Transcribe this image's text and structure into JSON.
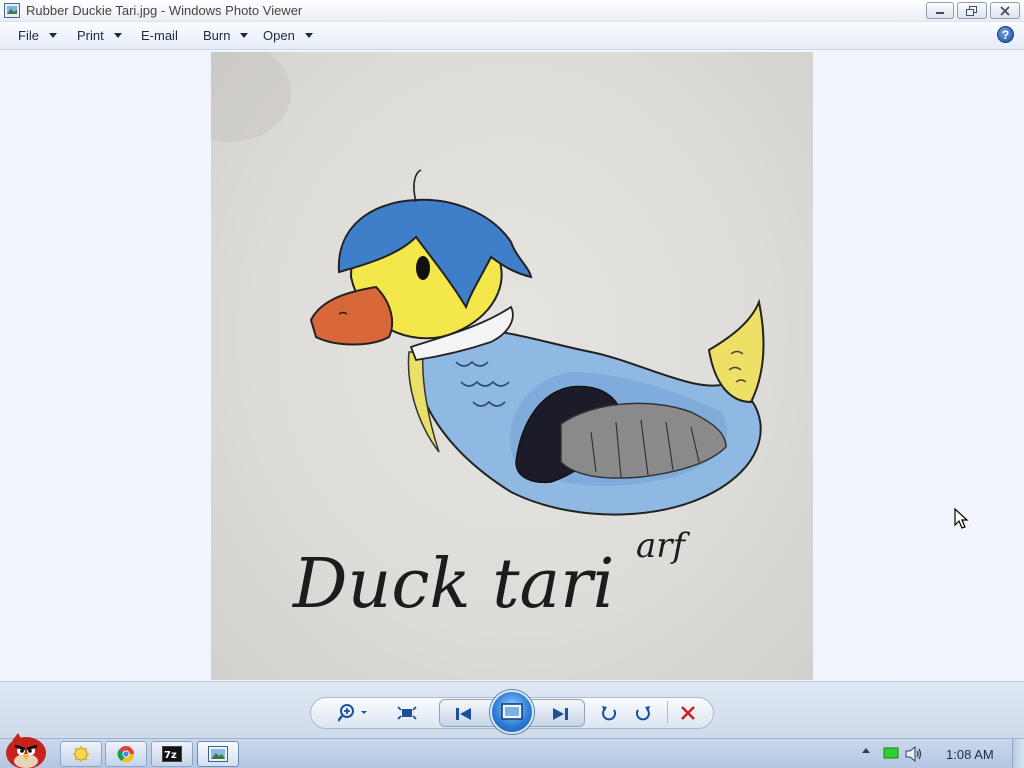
{
  "window": {
    "title": "Rubber Duckie Tari.jpg - Windows Photo Viewer"
  },
  "menu": {
    "items": [
      {
        "label": "File",
        "has_caret": true
      },
      {
        "label": "Print",
        "has_caret": true
      },
      {
        "label": "E-mail",
        "has_caret": false
      },
      {
        "label": "Burn",
        "has_caret": true
      },
      {
        "label": "Open",
        "has_caret": true
      }
    ],
    "help_label": "?"
  },
  "photo": {
    "caption_text": "Duck tari",
    "signature_text": "arf"
  },
  "controls": {
    "icons": [
      "zoom-icon",
      "fit-to-window-icon",
      "previous-icon",
      "slideshow-icon",
      "next-icon",
      "rotate-counterclockwise-icon",
      "rotate-clockwise-icon",
      "delete-icon"
    ]
  },
  "taskbar": {
    "start_icon": "angry-bird-orb-icon",
    "buttons": [
      "explorer-icon",
      "chrome-icon",
      "7zip-icon",
      "photo-viewer-icon"
    ],
    "tray_icons": [
      "show-hidden-icons-icon",
      "network-icon",
      "volume-icon"
    ],
    "clock": "1:08 AM"
  },
  "colors": {
    "accent": "#1d4f9c",
    "delete": "#cc2222",
    "viewer_background": "#f1f5fb"
  }
}
